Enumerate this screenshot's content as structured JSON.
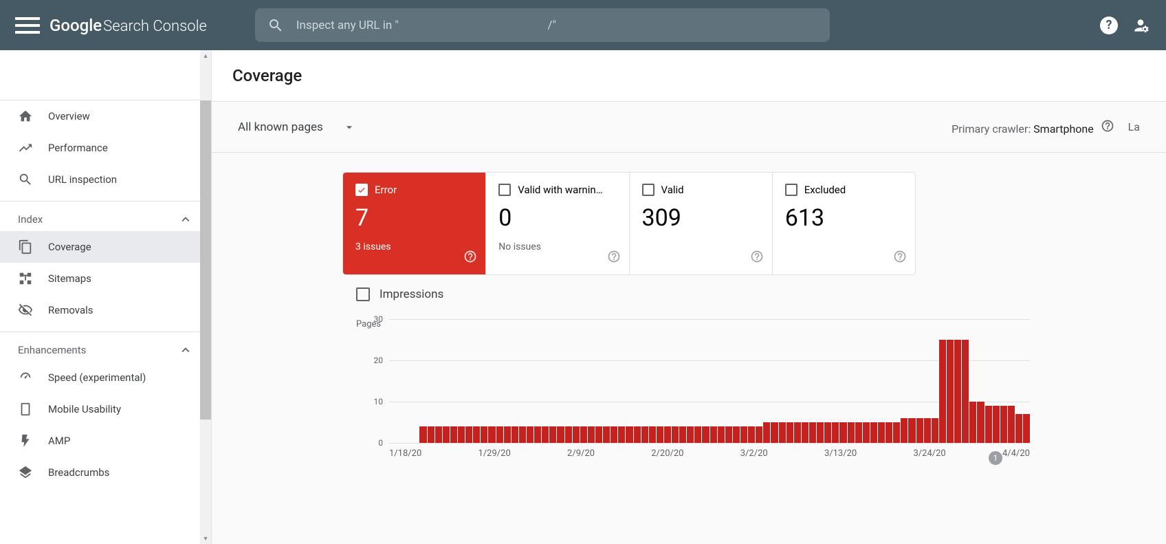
{
  "header": {
    "logo_google": "Google",
    "logo_product": "Search Console",
    "search_placeholder": "Inspect any URL in \"",
    "search_caret": "/\""
  },
  "sidebar": {
    "items_top": [
      {
        "label": "Overview"
      },
      {
        "label": "Performance"
      },
      {
        "label": "URL inspection"
      }
    ],
    "section_index": "Index",
    "items_index": [
      {
        "label": "Coverage",
        "active": true
      },
      {
        "label": "Sitemaps"
      },
      {
        "label": "Removals"
      }
    ],
    "section_enh": "Enhancements",
    "items_enh": [
      {
        "label": "Speed (experimental)"
      },
      {
        "label": "Mobile Usability"
      },
      {
        "label": "AMP"
      },
      {
        "label": "Breadcrumbs"
      }
    ]
  },
  "page": {
    "title": "Coverage",
    "filter": "All known pages",
    "crawler_label": "Primary crawler: ",
    "crawler_value": "Smartphone",
    "last_update_partial": "La"
  },
  "cards": {
    "error": {
      "label": "Error",
      "value": "7",
      "sub": "3 issues"
    },
    "warn": {
      "label": "Valid with warnin…",
      "value": "0",
      "sub": "No issues"
    },
    "valid": {
      "label": "Valid",
      "value": "309",
      "sub": ""
    },
    "excluded": {
      "label": "Excluded",
      "value": "613",
      "sub": ""
    }
  },
  "impressions_label": "Impressions",
  "chart_data": {
    "type": "bar",
    "title": "",
    "ylabel": "Pages",
    "xlabel": "",
    "ylim": [
      0,
      30
    ],
    "y_ticks": [
      0,
      10,
      20,
      30
    ],
    "x_ticks": [
      "1/18/20",
      "1/29/20",
      "2/9/20",
      "2/20/20",
      "3/2/20",
      "3/13/20",
      "3/24/20",
      "4/4/20"
    ],
    "values": [
      0,
      0,
      0,
      0,
      4,
      4,
      4,
      4,
      4,
      4,
      4,
      4,
      4,
      4,
      4,
      4,
      4,
      4,
      4,
      4,
      4,
      4,
      4,
      4,
      4,
      4,
      4,
      4,
      4,
      4,
      4,
      4,
      4,
      4,
      4,
      4,
      4,
      4,
      4,
      4,
      4,
      4,
      4,
      4,
      4,
      4,
      4,
      4,
      4,
      5,
      5,
      5,
      5,
      5,
      5,
      5,
      5,
      5,
      5,
      5,
      5,
      5,
      5,
      5,
      5,
      5,
      5,
      6,
      6,
      6,
      6,
      6,
      25,
      25,
      25,
      25,
      10,
      10,
      9,
      9,
      9,
      9,
      7,
      7
    ],
    "annotation": "1"
  }
}
